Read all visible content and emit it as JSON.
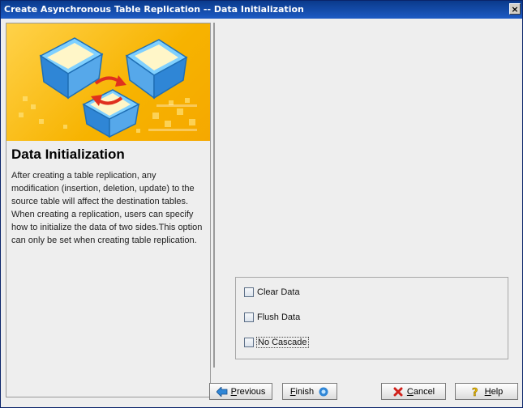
{
  "window": {
    "title": "Create Asynchronous Table Replication -- Data Initialization",
    "close_glyph": "×"
  },
  "left_panel": {
    "title": "Data Initialization",
    "description": "After creating a table replication, any modification (insertion, deletion, update) to the source table will affect the destination tables. When creating a replication, users can specify how to initialize the data of two sides.This option can only be set when creating table replication."
  },
  "options": [
    {
      "label": "Clear Data",
      "checked": false
    },
    {
      "label": "Flush Data",
      "checked": false
    },
    {
      "label": "No Cascade",
      "checked": false,
      "focused": true
    }
  ],
  "buttons": {
    "previous": {
      "mnemonic": "P",
      "rest": "revious",
      "icon": "arrow-left-icon"
    },
    "finish": {
      "mnemonic": "F",
      "rest": "inish",
      "icon": "finish-dot-icon"
    },
    "cancel": {
      "mnemonic": "C",
      "rest": "ancel",
      "icon": "cancel-x-icon"
    },
    "help": {
      "mnemonic": "H",
      "rest": "elp",
      "icon": "help-question-icon"
    }
  },
  "colors": {
    "titlebar": "#0a3a8c",
    "banner": "#f7b300",
    "accent_blue": "#2f86d6",
    "cancel_red": "#d0201a"
  }
}
